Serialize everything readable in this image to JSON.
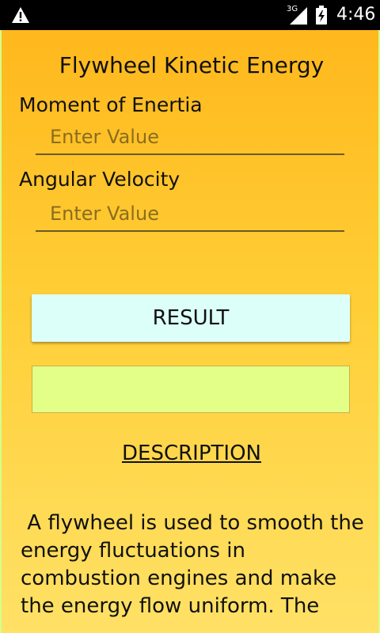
{
  "status_bar": {
    "network": "3G",
    "time": "4:46",
    "icons": [
      "warning-icon",
      "signal-icon",
      "battery-charging-icon"
    ]
  },
  "app": {
    "title": "Flywheel Kinetic Energy",
    "fields": [
      {
        "label": "Moment of Enertia",
        "placeholder": "Enter Value",
        "value": ""
      },
      {
        "label": "Angular Velocity",
        "placeholder": "Enter Value",
        "value": ""
      }
    ],
    "result_button_label": "RESULT",
    "result_value": "",
    "description_heading": "DESCRIPTION",
    "description_text": " A flywheel is used to smooth the energy fluctuations in combustion engines and make the energy flow uniform. The"
  },
  "colors": {
    "status_bar": "#000000",
    "background_top": "#ffb81d",
    "background_bottom": "#ffe166",
    "result_button": "#dcfff9",
    "result_box": "#e3ff88"
  }
}
